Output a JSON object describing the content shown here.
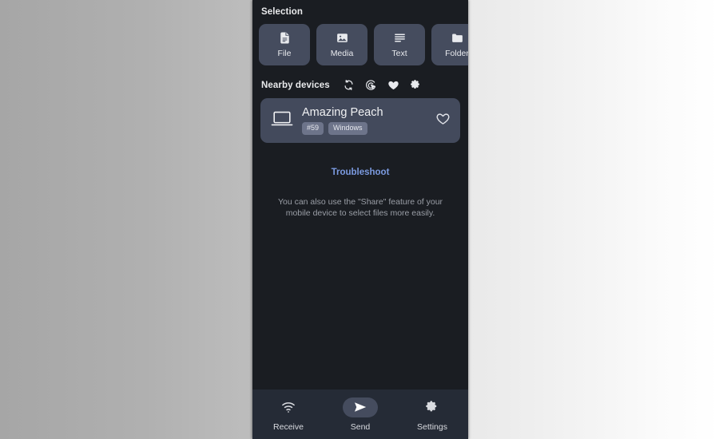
{
  "app": {
    "background_left": "#a8a8a8",
    "background_right": "#ffffff",
    "panel_bg": "#1a1d22",
    "card_bg": "#434a5c",
    "accent_link": "#7b9ae0"
  },
  "selection": {
    "title": "Selection",
    "buttons": [
      {
        "label": "File",
        "icon": "file-icon"
      },
      {
        "label": "Media",
        "icon": "media-icon"
      },
      {
        "label": "Text",
        "icon": "text-icon"
      },
      {
        "label": "Folder",
        "icon": "folder-icon"
      }
    ]
  },
  "nearby": {
    "title": "Nearby devices",
    "actions": [
      {
        "name": "refresh-icon"
      },
      {
        "name": "scan-icon"
      },
      {
        "name": "favorites-icon"
      },
      {
        "name": "settings-icon"
      }
    ],
    "devices": [
      {
        "name": "Amazing Peach",
        "icon": "laptop-icon",
        "badges": [
          "#59",
          "Windows"
        ],
        "favorite": false
      }
    ]
  },
  "help": {
    "troubleshoot_label": "Troubleshoot",
    "hint": "You can also use the \"Share\" feature of your mobile device to select files more easily."
  },
  "bottom_nav": {
    "items": [
      {
        "label": "Receive",
        "icon": "wifi-icon",
        "active": false
      },
      {
        "label": "Send",
        "icon": "send-icon",
        "active": true
      },
      {
        "label": "Settings",
        "icon": "gear-icon",
        "active": false
      }
    ]
  }
}
